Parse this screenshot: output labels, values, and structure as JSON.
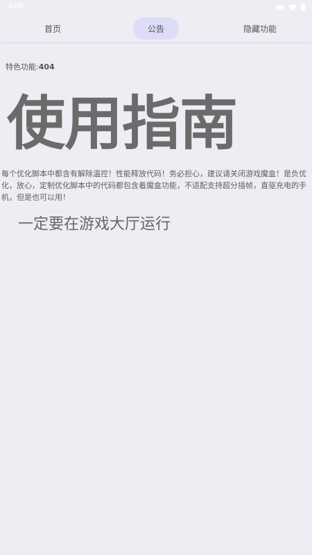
{
  "status_bar": {
    "time": "4:09"
  },
  "tabs": [
    {
      "label": "首页",
      "active": false
    },
    {
      "label": "公告",
      "active": true
    },
    {
      "label": "隐藏功能",
      "active": false
    }
  ],
  "feature": {
    "label": "特色功能:",
    "value": "404"
  },
  "guide": {
    "title": "使用指南",
    "description": "每个优化脚本中都含有解除温控！性能释放代码！务必担心，建议请关闭游戏魔盒！是负优化，放心，定制优化脚本中的代码都包含着魔盒功能，不适配支持超分插帧，直驱充电的手机，但是也可以用！",
    "note": "一定要在游戏大厅运行"
  },
  "colors": {
    "background": "#efedf4",
    "active_tab": "#dcdcf7",
    "text": "#6b6b6b"
  }
}
